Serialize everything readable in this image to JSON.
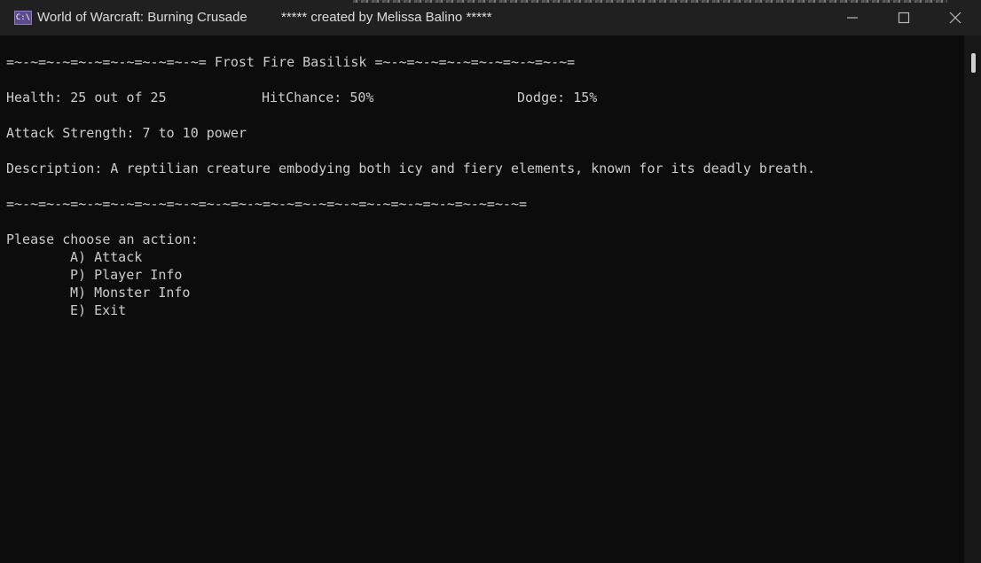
{
  "window": {
    "title": "World of Warcraft: Burning Crusade",
    "subtitle": "***** created by Melissa Balino *****",
    "icon_label": "C:\\"
  },
  "monster": {
    "header_left": "=~-~=~-~=~-~=~-~=~-~=~-~=",
    "name": "Frost Fire Basilisk",
    "header_right": "=~-~=~-~=~-~=~-~=~-~=~-~=",
    "health": "Health: 25 out of 25",
    "hit_chance": "HitChance: 50%",
    "dodge": "Dodge: 15%",
    "attack_strength": "Attack Strength: 7 to 10 power",
    "description": "Description: A reptilian creature embodying both icy and fiery elements, known for its deadly breath.",
    "divider": "=~-~=~-~=~-~=~-~=~-~=~-~=~-~=~-~=~-~=~-~=~-~=~-~=~-~=~-~=~-~=~-~="
  },
  "menu": {
    "prompt": "Please choose an action:",
    "options": [
      "A) Attack",
      "P) Player Info",
      "M) Monster Info",
      "E) Exit"
    ]
  }
}
